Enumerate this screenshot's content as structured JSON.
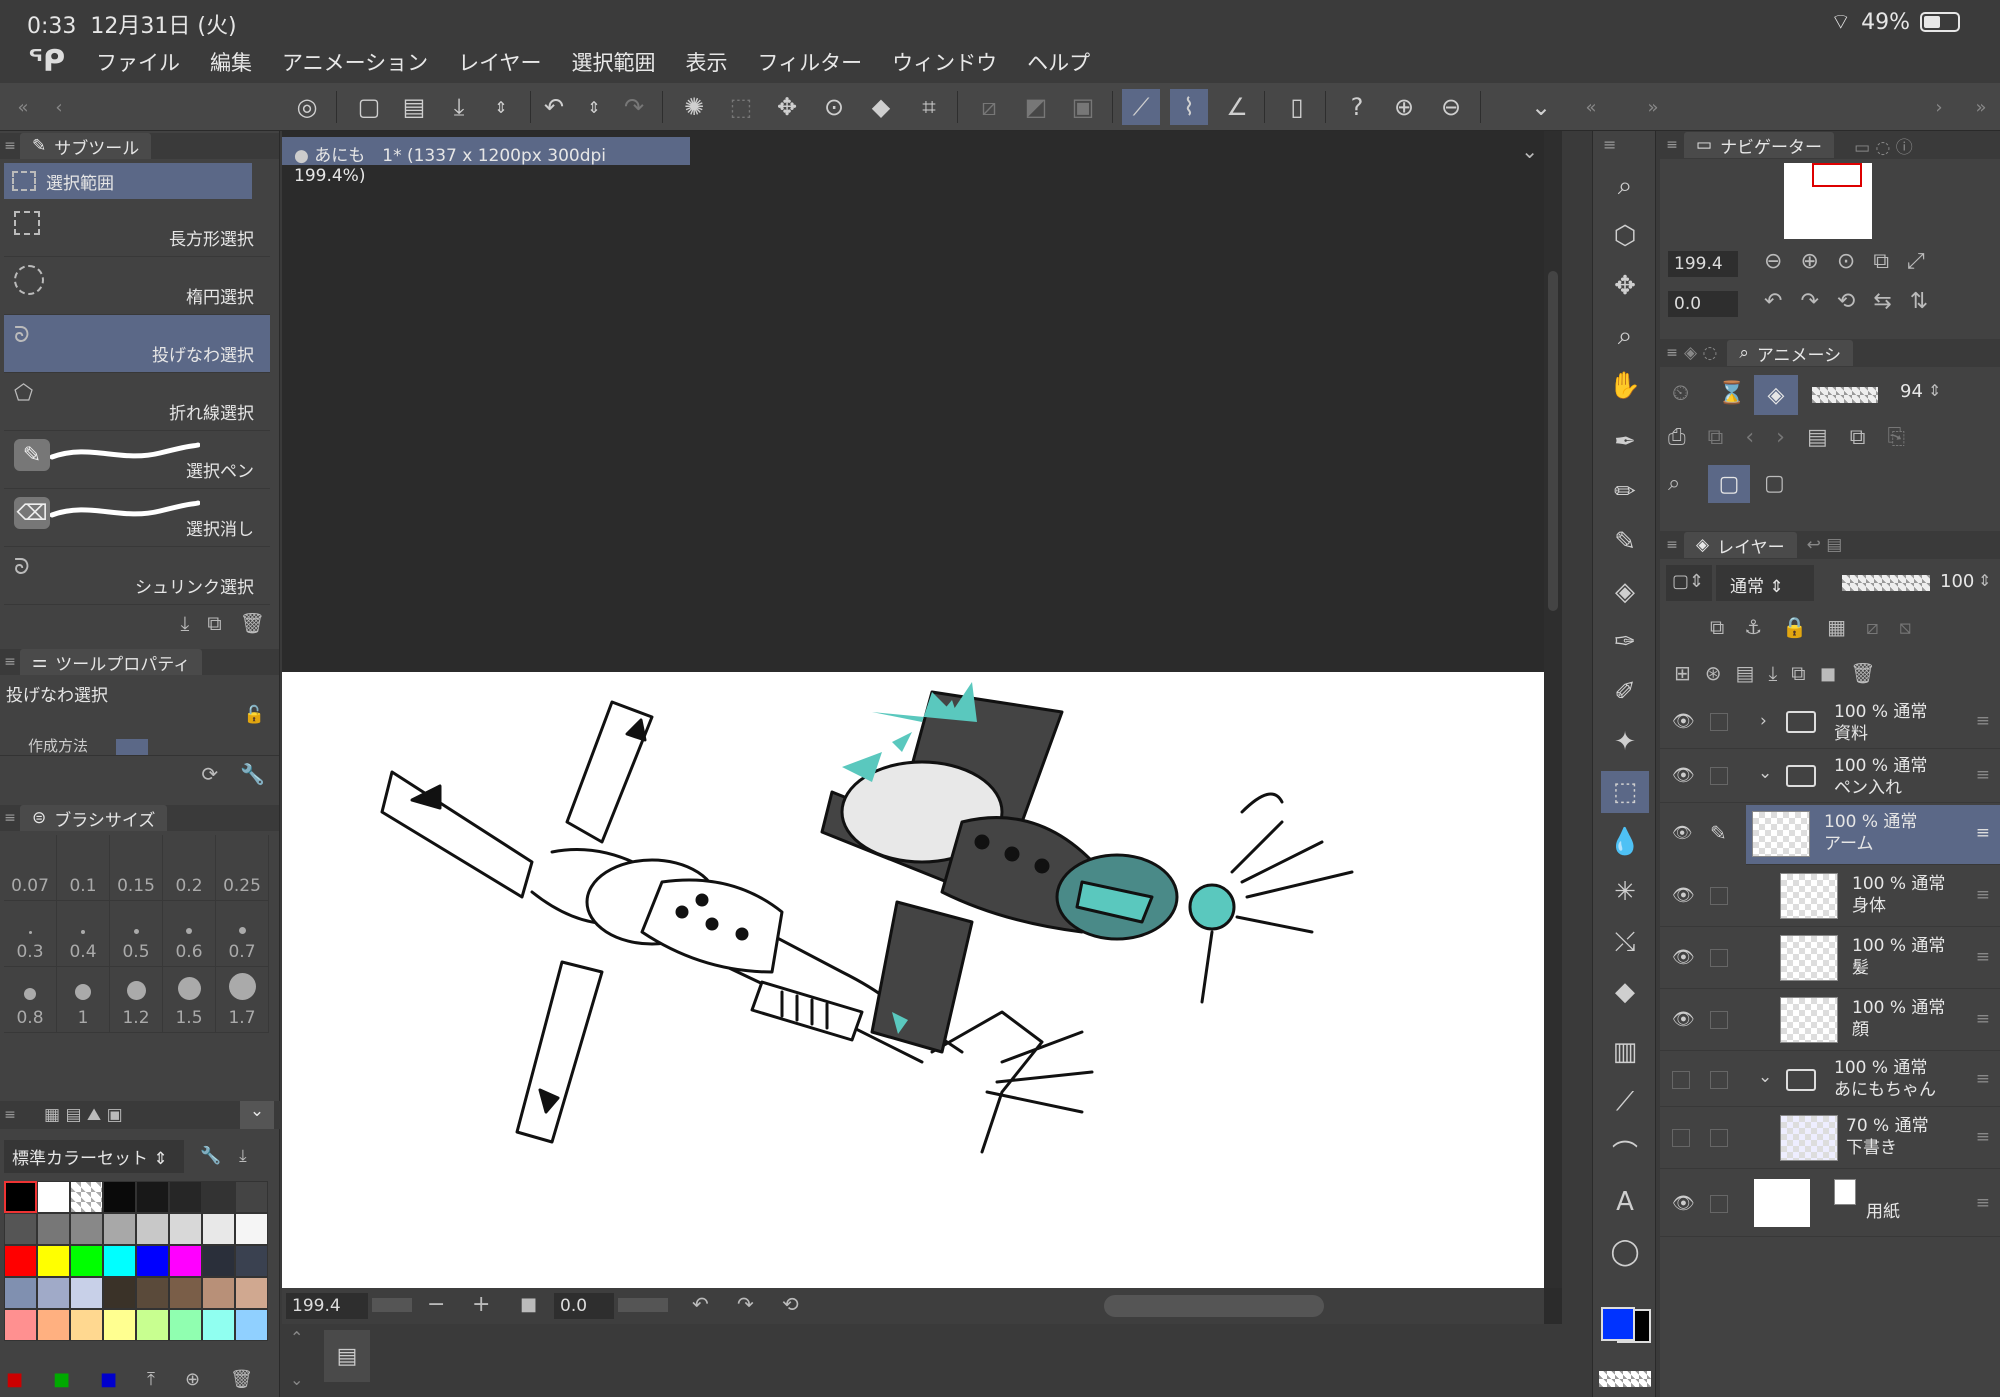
{
  "status": {
    "time": "0:33",
    "date": "12月31日 (火)",
    "battery": "49%",
    "battery_level": 0.49
  },
  "menu": {
    "items": [
      "ファイル",
      "編集",
      "アニメーション",
      "レイヤー",
      "選択範囲",
      "表示",
      "フィルター",
      "ウィンドウ",
      "ヘルプ"
    ]
  },
  "subtool": {
    "tab": "サブツール",
    "group": "選択範囲",
    "items": [
      {
        "label": "長方形選択",
        "icon": "rect-select-icon"
      },
      {
        "label": "楕円選択",
        "icon": "ellipse-select-icon"
      },
      {
        "label": "投げなわ選択",
        "icon": "lasso-icon"
      },
      {
        "label": "折れ線選択",
        "icon": "polyline-icon"
      },
      {
        "label": "選択ペン",
        "icon": "select-pen-icon"
      },
      {
        "label": "選択消し",
        "icon": "select-erase-icon"
      },
      {
        "label": "シュリンク選択",
        "icon": "shrink-lasso-icon"
      }
    ]
  },
  "toolprop": {
    "tab": "ツールプロパティ",
    "tool": "投げなわ選択",
    "row": "作成方法"
  },
  "brushsize": {
    "tab": "ブラシサイズ",
    "sizes": [
      "0.07",
      "0.1",
      "0.15",
      "0.2",
      "0.25",
      "0.3",
      "0.4",
      "0.5",
      "0.6",
      "0.7",
      "0.8",
      "1",
      "1.2",
      "1.5",
      "1.7"
    ]
  },
  "colorset": {
    "name": "標準カラーセット"
  },
  "document": {
    "tab": "あにも　1* (1337 x 1200px 300dpi 199.4%)"
  },
  "canvasbar": {
    "zoom": "199.4",
    "rotation": "0.0"
  },
  "navigator": {
    "tab": "ナビゲーター",
    "zoom": "199.4",
    "rotation": "0.0"
  },
  "animation": {
    "tab": "アニメーシ",
    "opacity": "94"
  },
  "layers": {
    "tab": "レイヤー",
    "blend_mode": "通常",
    "opacity": "100",
    "list": [
      {
        "pct": "100 %",
        "mode": "通常",
        "name": "資料",
        "type": "folder",
        "visible": true,
        "collapsed": true
      },
      {
        "pct": "100 %",
        "mode": "通常",
        "name": "ペン入れ",
        "type": "folder",
        "visible": true,
        "collapsed": false
      },
      {
        "pct": "100 %",
        "mode": "通常",
        "name": "アーム",
        "type": "layer",
        "visible": true,
        "selected": true
      },
      {
        "pct": "100 %",
        "mode": "通常",
        "name": "身体",
        "type": "layer",
        "visible": true
      },
      {
        "pct": "100 %",
        "mode": "通常",
        "name": "髪",
        "type": "layer",
        "visible": true
      },
      {
        "pct": "100 %",
        "mode": "通常",
        "name": "顔",
        "type": "layer",
        "visible": true
      },
      {
        "pct": "100 %",
        "mode": "通常",
        "name": "あにもちゃん",
        "type": "folder",
        "visible": false,
        "collapsed": false
      },
      {
        "pct": "70 %",
        "mode": "通常",
        "name": "下書き",
        "type": "layer",
        "visible": false
      },
      {
        "pct": "",
        "mode": "",
        "name": "用紙",
        "type": "paper",
        "visible": true
      }
    ]
  },
  "colors": {
    "accent": "#5b6887",
    "main_color": "#0033ff",
    "sub_color": "#000000",
    "teal": "#5ac8be"
  }
}
